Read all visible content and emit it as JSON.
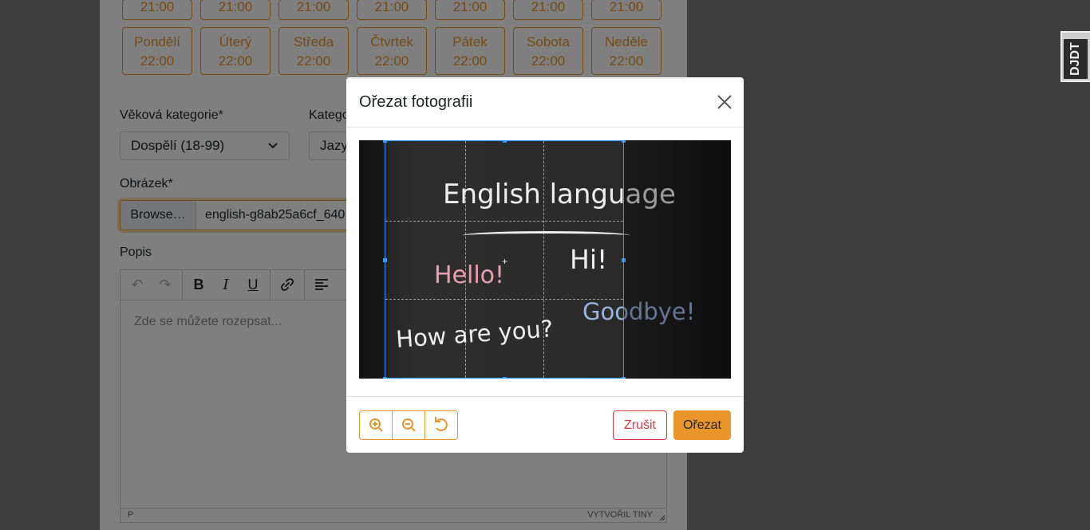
{
  "schedule": {
    "prev_times": [
      "21:00",
      "21:00",
      "21:00",
      "21:00",
      "21:00",
      "21:00",
      "21:00"
    ],
    "days": [
      {
        "day": "Pondělí",
        "time": "22:00"
      },
      {
        "day": "Úterý",
        "time": "22:00"
      },
      {
        "day": "Středa",
        "time": "22:00"
      },
      {
        "day": "Čtvrtek",
        "time": "22:00"
      },
      {
        "day": "Pátek",
        "time": "22:00"
      },
      {
        "day": "Sobota",
        "time": "22:00"
      },
      {
        "day": "Neděle",
        "time": "22:00"
      }
    ]
  },
  "form": {
    "age_label": "Věková kategorie*",
    "age_value": "Dospělí (18-99)",
    "category_label": "Katego",
    "category_value": "Jazyk",
    "image_label": "Obrázek*",
    "browse_label": "Browse…",
    "file_name": "english-g8ab25a6cf_640",
    "description_label": "Popis",
    "editor_placeholder": "Zde se můžete rozepsat...",
    "status_path": "P",
    "status_brand": "VYTVOŘIL TINY"
  },
  "debug_toolbar": {
    "label": "DJDT"
  },
  "modal": {
    "title": "Ořezat fotografii",
    "image_text": {
      "heading": "English language",
      "hello": "Hello!",
      "hi": "Hi!",
      "goodbye": "Goodbye!",
      "how": "How are you?"
    },
    "cancel_label": "Zrušit",
    "crop_label": "Ořezat"
  },
  "colors": {
    "accent": "#e8952a",
    "danger": "#dc3545",
    "crop_border": "#3399ff"
  }
}
